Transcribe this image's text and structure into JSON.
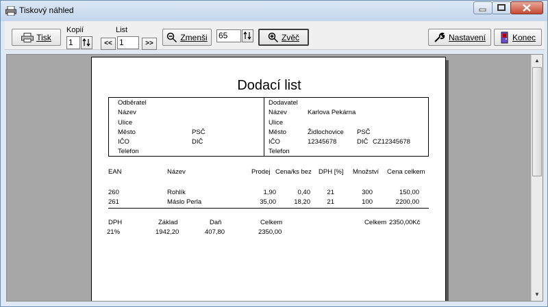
{
  "window": {
    "title": "Tiskový náhled"
  },
  "toolbar": {
    "print_label": "Tisk",
    "copies_label": "Kopií",
    "copies_value": "1",
    "sheet_label": "List",
    "prev_label": "<<",
    "sheet_value": "1",
    "next_label": ">>",
    "zoom_out_label": "Zmenši",
    "zoom_value": "65",
    "zoom_in_label": "Zvěč",
    "settings_label": "Nastavení",
    "close_label": "Konec"
  },
  "document": {
    "title": "Dodací list",
    "customer": {
      "header": "Odběratel",
      "name_label": "Název",
      "street_label": "Ulice",
      "city_label": "Město",
      "zip_label": "PSČ",
      "ico_label": "IČO",
      "dic_label": "DIČ",
      "phone_label": "Telefon"
    },
    "supplier": {
      "header": "Dodavatel",
      "name_label": "Název",
      "name_value": "Karlova Pekárna",
      "street_label": "Ulice",
      "city_label": "Město",
      "city_value": "Židlochovice",
      "zip_label": "PSČ",
      "ico_label": "IČO",
      "ico_value": "12345678",
      "dic_label": "DIČ",
      "dic_value": "CZ12345678",
      "phone_label": "Telefon"
    },
    "items_header": {
      "ean": "EAN",
      "name": "Název",
      "price": "Prodej",
      "price_ex": "Cena/ks bez",
      "vat": "DPH [%]",
      "qty": "Množství",
      "total": "Cena celkem"
    },
    "items": [
      {
        "ean": "260",
        "name": "Rohlík",
        "price": "1,90",
        "price_ex": "0,40",
        "vat": "21",
        "qty": "300",
        "total": "150,00"
      },
      {
        "ean": "261",
        "name": "Máslo Perla",
        "price": "35,00",
        "price_ex": "18,20",
        "vat": "21",
        "qty": "100",
        "total": "2200,00"
      }
    ],
    "summary_header": {
      "vat": "DPH",
      "base": "Základ",
      "tax": "Daň",
      "total": "Celkem"
    },
    "summary_row": {
      "vat": "21%",
      "base": "1942,20",
      "tax": "407,80",
      "total": "2350,00"
    },
    "grand_total_label": "Celkem",
    "grand_total_value": "2350,00Kč"
  }
}
